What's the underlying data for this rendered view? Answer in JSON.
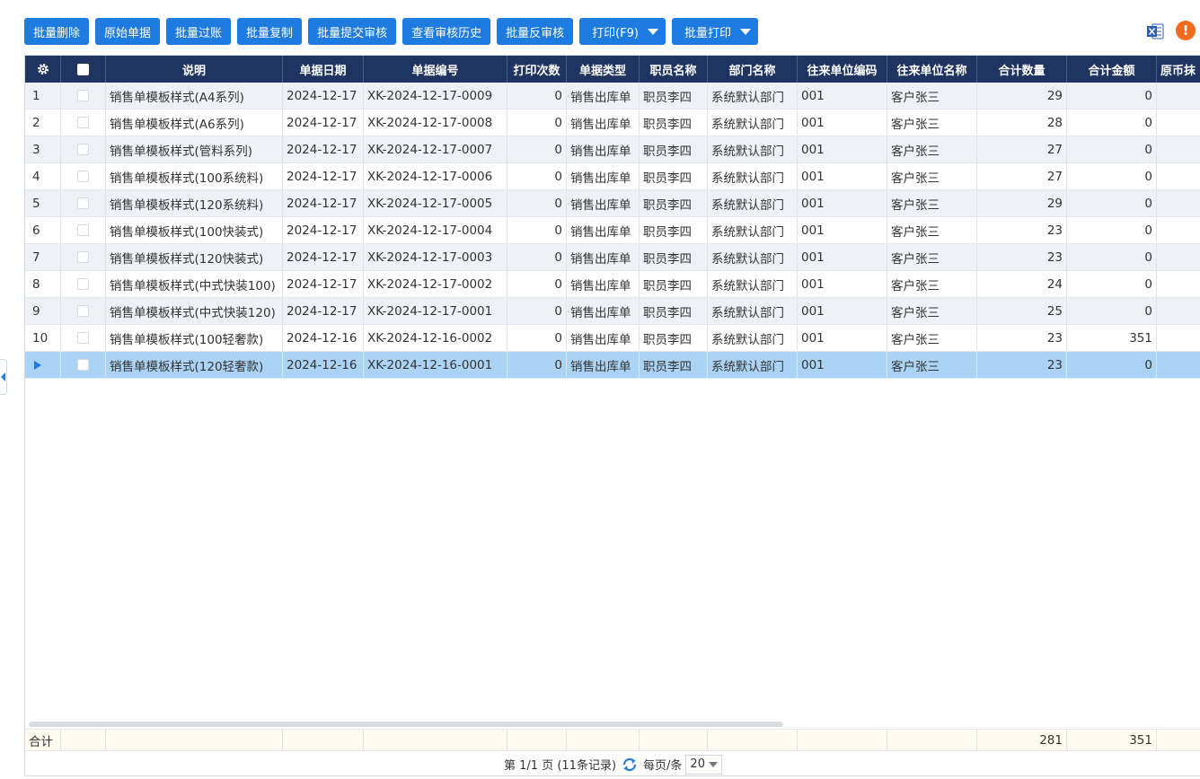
{
  "toolbar": {
    "buttons": [
      {
        "label": "批量删除"
      },
      {
        "label": "原始单据"
      },
      {
        "label": "批量过账"
      },
      {
        "label": "批量复制"
      },
      {
        "label": "批量提交审核"
      },
      {
        "label": "查看审核历史"
      },
      {
        "label": "批量反审核"
      },
      {
        "label": "打印(F9)"
      },
      {
        "label": "批量打印"
      }
    ]
  },
  "table": {
    "headers": [
      "说明",
      "单据日期",
      "单据编号",
      "打印次数",
      "单据类型",
      "职员名称",
      "部门名称",
      "往来单位编码",
      "往来单位名称",
      "合计数量",
      "合计金额",
      "原币抹"
    ],
    "rows": [
      {
        "no": "1",
        "desc": "销售单模板样式(A4系列)",
        "date": "2024-12-17",
        "code": "XK-2024-12-17-0009",
        "prints": "0",
        "type": "销售出库单",
        "staff": "职员李四",
        "dept": "系统默认部门",
        "pcode": "001",
        "pname": "客户张三",
        "qty": "29",
        "amt": "0"
      },
      {
        "no": "2",
        "desc": "销售单模板样式(A6系列)",
        "date": "2024-12-17",
        "code": "XK-2024-12-17-0008",
        "prints": "0",
        "type": "销售出库单",
        "staff": "职员李四",
        "dept": "系统默认部门",
        "pcode": "001",
        "pname": "客户张三",
        "qty": "28",
        "amt": "0"
      },
      {
        "no": "3",
        "desc": "销售单模板样式(管料系列)",
        "date": "2024-12-17",
        "code": "XK-2024-12-17-0007",
        "prints": "0",
        "type": "销售出库单",
        "staff": "职员李四",
        "dept": "系统默认部门",
        "pcode": "001",
        "pname": "客户张三",
        "qty": "27",
        "amt": "0"
      },
      {
        "no": "4",
        "desc": "销售单模板样式(100系统料)",
        "date": "2024-12-17",
        "code": "XK-2024-12-17-0006",
        "prints": "0",
        "type": "销售出库单",
        "staff": "职员李四",
        "dept": "系统默认部门",
        "pcode": "001",
        "pname": "客户张三",
        "qty": "27",
        "amt": "0"
      },
      {
        "no": "5",
        "desc": "销售单模板样式(120系统料)",
        "date": "2024-12-17",
        "code": "XK-2024-12-17-0005",
        "prints": "0",
        "type": "销售出库单",
        "staff": "职员李四",
        "dept": "系统默认部门",
        "pcode": "001",
        "pname": "客户张三",
        "qty": "29",
        "amt": "0"
      },
      {
        "no": "6",
        "desc": "销售单模板样式(100快装式)",
        "date": "2024-12-17",
        "code": "XK-2024-12-17-0004",
        "prints": "0",
        "type": "销售出库单",
        "staff": "职员李四",
        "dept": "系统默认部门",
        "pcode": "001",
        "pname": "客户张三",
        "qty": "23",
        "amt": "0"
      },
      {
        "no": "7",
        "desc": "销售单模板样式(120快装式)",
        "date": "2024-12-17",
        "code": "XK-2024-12-17-0003",
        "prints": "0",
        "type": "销售出库单",
        "staff": "职员李四",
        "dept": "系统默认部门",
        "pcode": "001",
        "pname": "客户张三",
        "qty": "23",
        "amt": "0"
      },
      {
        "no": "8",
        "desc": "销售单模板样式(中式快装100)",
        "date": "2024-12-17",
        "code": "XK-2024-12-17-0002",
        "prints": "0",
        "type": "销售出库单",
        "staff": "职员李四",
        "dept": "系统默认部门",
        "pcode": "001",
        "pname": "客户张三",
        "qty": "24",
        "amt": "0"
      },
      {
        "no": "9",
        "desc": "销售单模板样式(中式快装120)",
        "date": "2024-12-17",
        "code": "XK-2024-12-17-0001",
        "prints": "0",
        "type": "销售出库单",
        "staff": "职员李四",
        "dept": "系统默认部门",
        "pcode": "001",
        "pname": "客户张三",
        "qty": "25",
        "amt": "0"
      },
      {
        "no": "10",
        "desc": "销售单模板样式(100轻奢款)",
        "date": "2024-12-16",
        "code": "XK-2024-12-16-0002",
        "prints": "0",
        "type": "销售出库单",
        "staff": "职员李四",
        "dept": "系统默认部门",
        "pcode": "001",
        "pname": "客户张三",
        "qty": "23",
        "amt": "351"
      },
      {
        "no": "",
        "desc": "销售单模板样式(120轻奢款)",
        "date": "2024-12-16",
        "code": "XK-2024-12-16-0001",
        "prints": "0",
        "type": "销售出库单",
        "staff": "职员李四",
        "dept": "系统默认部门",
        "pcode": "001",
        "pname": "客户张三",
        "qty": "23",
        "amt": "0",
        "selected": true
      }
    ],
    "summary": {
      "label": "合计",
      "qty": "281",
      "amt": "351"
    }
  },
  "pager": {
    "info": "第 1/1 页 (11条记录)",
    "per_page_label": "每页/条",
    "per_page_value": "20"
  },
  "colors": {
    "accent": "#1e7be0",
    "header_bg": "#1f3460",
    "selected_row": "#abd3f5",
    "warn": "#f06a1d"
  }
}
